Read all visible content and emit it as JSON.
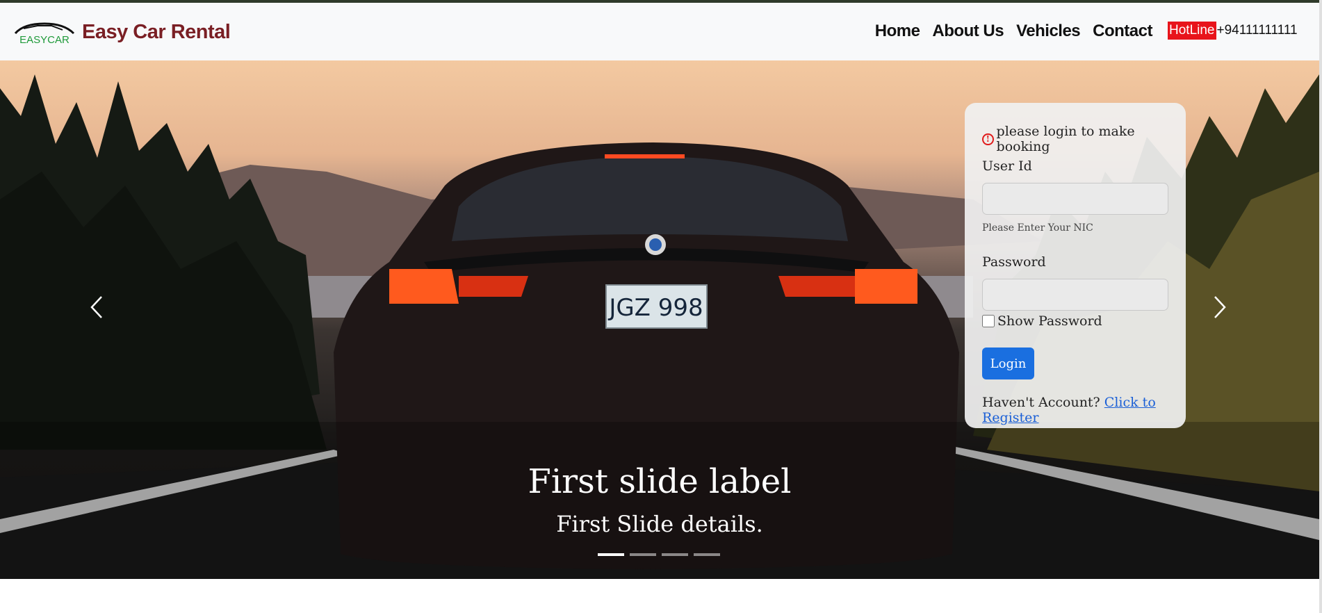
{
  "navbar": {
    "logo_text": "EASYCAR",
    "brand": "Easy Car Rental",
    "links": [
      "Home",
      "About Us",
      "Vehicles",
      "Contact"
    ],
    "hotline_label": "HotLine",
    "hotline_number": "+94111111111"
  },
  "carousel": {
    "caption_title": "First slide label",
    "caption_text": "First Slide details.",
    "slides_count": 4,
    "active_slide": 1,
    "plate_text": "JGZ 998"
  },
  "login": {
    "notice": "please login to make booking",
    "userid_label": "User Id",
    "userid_hint": "Please Enter Your NIC",
    "password_label": "Password",
    "show_password_label": "Show Password",
    "login_button": "Login",
    "register_prompt": "Haven't Account?",
    "register_link": "Click to Register"
  },
  "colors": {
    "brand": "#7a1f24",
    "hotline_badge": "#e8141b",
    "primary_button": "#1a6fe0",
    "link": "#1a5fd6"
  }
}
